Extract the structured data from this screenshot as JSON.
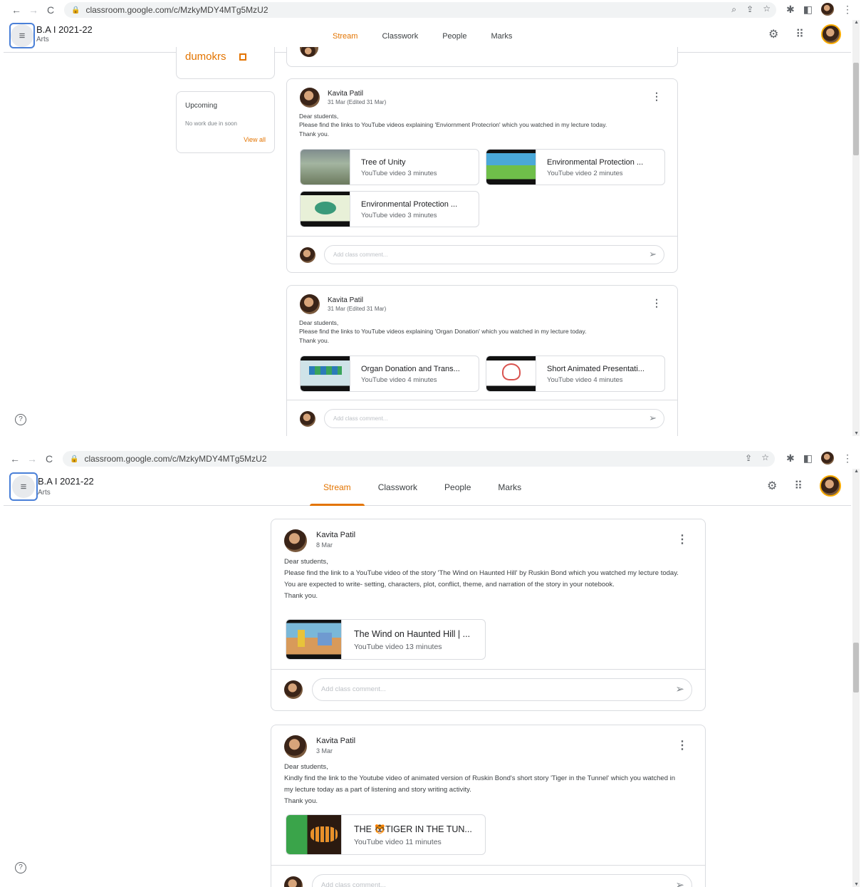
{
  "browser": {
    "url": "classroom.google.com/c/MzkyMDY4MTg5MzU2",
    "back_icon": "arrow-left-icon",
    "forward_icon": "arrow-right-icon",
    "reload_icon": "reload-icon"
  },
  "class": {
    "title": "B.A I 2021-22",
    "subtitle": "Arts",
    "code": "dumokrs"
  },
  "tabs": [
    "Stream",
    "Classwork",
    "People",
    "Marks"
  ],
  "active_tab": "Stream",
  "upcoming": {
    "title": "Upcoming",
    "none_text": "No work due in soon",
    "view_all": "View all"
  },
  "comment_placeholder": "Add class comment...",
  "posts_top": [
    {
      "author": "Kavita Patil",
      "date": "31 Mar (Edited 31 Mar)",
      "body": [
        "Dear students,",
        "Please find the links to YouTube videos explaining 'Enviornment Protecrion' which you watched in my lecture today.",
        "Thank you."
      ],
      "attachments": [
        {
          "title": "Tree of Unity",
          "meta": "YouTube video   3 minutes"
        },
        {
          "title": "Environmental Protection ...",
          "meta": "YouTube video   2 minutes"
        },
        {
          "title": "Environmental Protection ...",
          "meta": "YouTube video   3 minutes"
        }
      ]
    },
    {
      "author": "Kavita Patil",
      "date": "31 Mar (Edited 31 Mar)",
      "body": [
        "Dear students,",
        "Please find the links to YouTube videos explaining 'Organ Donation' which you watched in my lecture today.",
        "Thank you."
      ],
      "attachments": [
        {
          "title": "Organ Donation and Trans...",
          "meta": "YouTube video   4 minutes"
        },
        {
          "title": "Short Animated Presentati...",
          "meta": "YouTube video   4 minutes"
        }
      ]
    }
  ],
  "posts_bottom": [
    {
      "author": "Kavita Patil",
      "date": "8 Mar",
      "body": [
        "Dear students,",
        "Please find the link to a YouTube video of the story 'The Wind on Haunted Hill' by Ruskin Bond which you watched my lecture today.",
        "You are expected to write- setting, characters, plot, conflict, theme, and narration of the story in your notebook.",
        "Thank you."
      ],
      "attachments": [
        {
          "title": "The Wind on Haunted Hill | ...",
          "meta": "YouTube video   13 minutes"
        }
      ]
    },
    {
      "author": "Kavita Patil",
      "date": "3 Mar",
      "body": [
        "Dear students,",
        "Kindly find the link to the Youtube video of animated version of Ruskin Bond's short story 'Tiger in the Tunnel' which you watched in my lecture today as a part of listening and story writing activity.",
        "Thank you."
      ],
      "attachments": [
        {
          "title": "THE 🐯TIGER IN THE TUN...",
          "meta": "YouTube video   11 minutes"
        }
      ]
    }
  ],
  "icons": {
    "menu": "menu-icon",
    "settings": "gear-icon",
    "apps": "apps-grid-icon",
    "help": "help-icon",
    "send": "send-icon",
    "more": "more-vert-icon"
  },
  "colors": {
    "accent": "#e37400",
    "border": "#dadce0"
  }
}
